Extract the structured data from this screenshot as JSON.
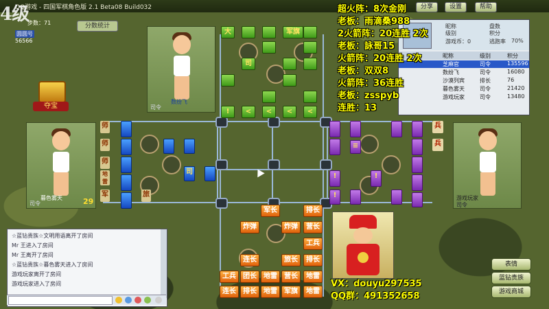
{
  "titlebar": {
    "title": "QQ游戏 - 四国军棋角色版 2.1 Beta08 Build032",
    "btn_help": "帮助",
    "btn_settings": "设置",
    "btn_share": "分享"
  },
  "header": {
    "logo_text": "4级",
    "steps": "步数：71",
    "user_badge": "圆圆号",
    "user_id": "56566",
    "score_tab": "分数统计"
  },
  "treasure": {
    "label": "夺宝"
  },
  "players": {
    "top": {
      "name": "数纷飞",
      "rank": "司令"
    },
    "left": {
      "name": "暮色雾天",
      "rank": "司令",
      "count": "29"
    },
    "right": {
      "name": "游戏玩家",
      "rank": "司令"
    },
    "bottom": {
      "name": "",
      "rank": ""
    }
  },
  "stream_text": [
    "超火阵：8次金刚",
    "老板：雨滴桑988",
    "2火箭阵：20连胜 2次",
    "老板：詠哥15",
    "火箭阵：20连胜 2次",
    "老板：双双8",
    "火箭阵：36连胜",
    "老板：zsspyb",
    "连胜：13"
  ],
  "infopanel": {
    "nickname_label": "昵称",
    "level_label": "级别",
    "coins_label": "游戏币：0",
    "plate_label": "盘数",
    "points_label": "积分",
    "escape_label": "逃跑率",
    "escape_value": "70%",
    "columns": [
      "昵称",
      "级别",
      "积分"
    ],
    "rows": [
      {
        "name": "芝麻官",
        "level": "司令",
        "points": "135596"
      },
      {
        "name": "数纷飞",
        "level": "司令",
        "points": "16080"
      },
      {
        "name": "沙漠列宾",
        "level": "排长",
        "points": "76"
      },
      {
        "name": "暮色雾天",
        "level": "司令",
        "points": "21420"
      },
      {
        "name": "游戏玩家",
        "level": "司令",
        "points": "13480"
      }
    ]
  },
  "chat": {
    "lines": [
      "☆蓝钻贵族☆文明用语离开了房间",
      "Mr 王进入了房间",
      "Mr 王离开了房间",
      "☆蓝钻贵族☆暮色雾天进入了房间",
      "游戏玩家离开了房间",
      "游戏玩家进入了房间"
    ]
  },
  "contacts": {
    "vx": "VX：douyu297535",
    "qq": "QQ群：491352658"
  },
  "side_buttons": {
    "emote": "表情",
    "blue_diamond": "蓝钻贵族",
    "game_mall": "游戏商城"
  },
  "board": {
    "top_pieces": [
      "大",
      "军旗",
      "司",
      "!",
      "<",
      "<",
      "<",
      "<"
    ],
    "left_pieces": [
      "师",
      "师",
      "师",
      "地雷",
      "军",
      "旅",
      "司"
    ],
    "right_pieces": [
      "兵",
      "兵",
      "!",
      "!",
      "!",
      "≡"
    ],
    "bottom_pieces": [
      [
        "军长",
        "排长"
      ],
      [
        "炸弹",
        "炸弹",
        "营长"
      ],
      [
        "工兵"
      ],
      [
        "连长",
        "旅长",
        "排长"
      ],
      [
        "工兵",
        "团长",
        "地雷",
        "营长",
        "地雷"
      ],
      [
        "连长",
        "排长",
        "地雷",
        "军旗",
        "地雷"
      ]
    ]
  }
}
